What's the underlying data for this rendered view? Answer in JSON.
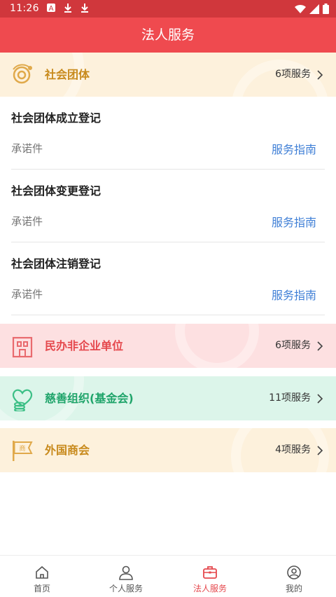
{
  "status_bar": {
    "time": "11:26"
  },
  "app_bar": {
    "title": "法人服务"
  },
  "colors": {
    "primary": "#ef4a4f",
    "link": "#3f7fd6",
    "gold": "#c88a1c",
    "green": "#1fa46a"
  },
  "categories": [
    {
      "title": "社会团体",
      "count": "6项服务",
      "icon": "globe-orbit-icon"
    },
    {
      "title": "民办非企业单位",
      "count": "6项服务",
      "icon": "building-icon"
    },
    {
      "title": "慈善组织(基金会)",
      "count": "11项服务",
      "icon": "heart-coins-icon"
    },
    {
      "title": "外国商会",
      "count": "4项服务",
      "icon": "merchant-flag-icon"
    }
  ],
  "services": [
    {
      "name": "社会团体成立登记",
      "type": "承诺件",
      "guide": "服务指南"
    },
    {
      "name": "社会团体变更登记",
      "type": "承诺件",
      "guide": "服务指南"
    },
    {
      "name": "社会团体注销登记",
      "type": "承诺件",
      "guide": "服务指南"
    }
  ],
  "tabs": [
    {
      "label": "首页",
      "icon": "home-icon"
    },
    {
      "label": "个人服务",
      "icon": "person-icon"
    },
    {
      "label": "法人服务",
      "icon": "briefcase-icon",
      "active": true
    },
    {
      "label": "我的",
      "icon": "profile-icon"
    }
  ]
}
